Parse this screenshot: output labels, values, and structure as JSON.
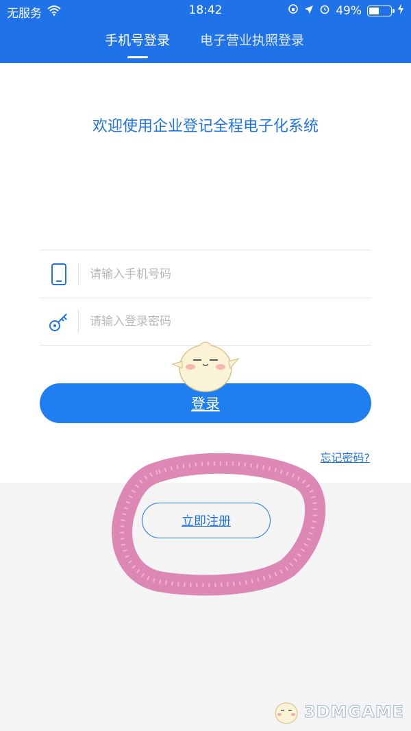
{
  "status_bar": {
    "carrier": "无服务",
    "time": "18:42",
    "battery": "49%",
    "battery_level": 0.49
  },
  "tabs": [
    {
      "label": "手机号登录",
      "active": true
    },
    {
      "label": "电子营业执照登录",
      "active": false
    }
  ],
  "welcome": "欢迎使用企业登记全程电子化系统",
  "form": {
    "phone_placeholder": "请输入手机号码",
    "password_placeholder": "请输入登录密码",
    "login_label": "登录",
    "forgot_label": "忘记密码?"
  },
  "register_label": "立即注册",
  "watermark": "3DMGAME",
  "colors": {
    "primary": "#1f72e8",
    "button": "#1f7ff0",
    "page_bg": "#f4f4f4",
    "highlight_doodle": "#d873a8"
  },
  "icons": [
    "wifi-icon",
    "location-icon",
    "alarm-icon",
    "orientation-lock-icon",
    "battery-icon",
    "charging-icon",
    "phone-icon",
    "key-icon"
  ]
}
